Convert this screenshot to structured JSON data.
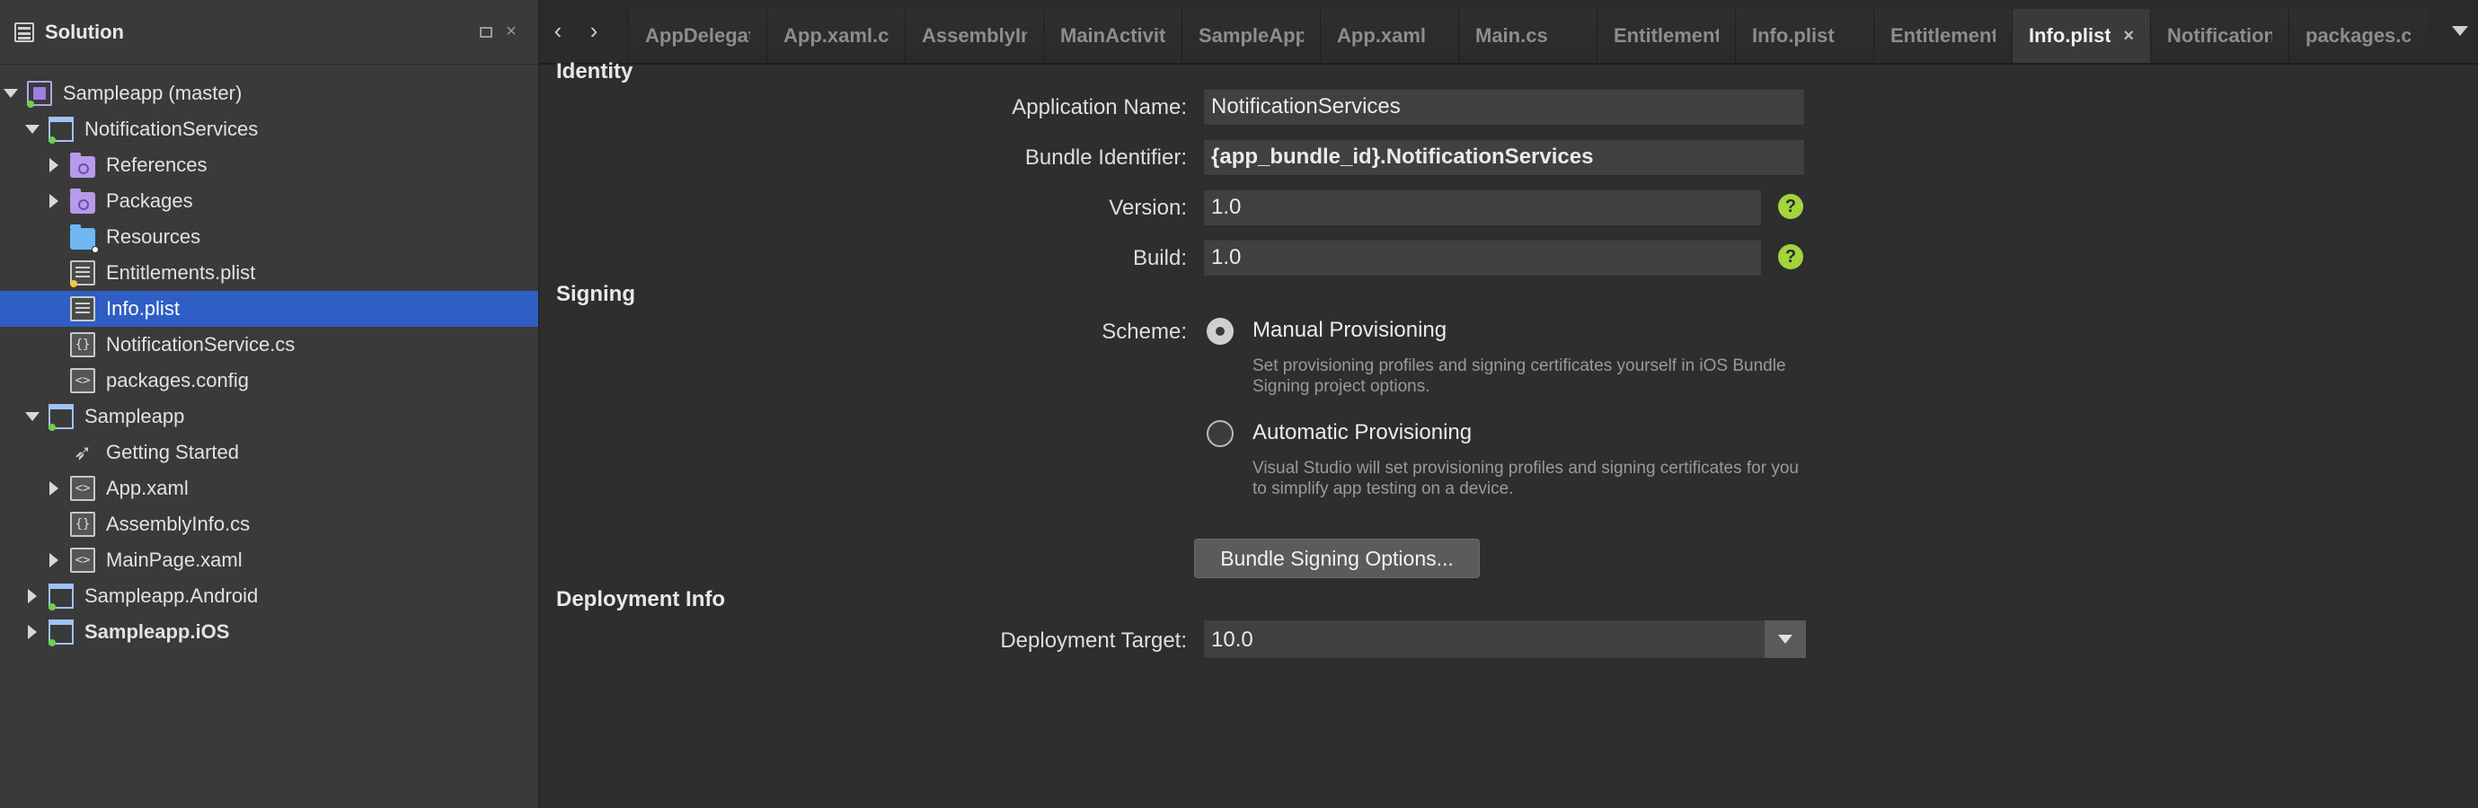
{
  "sidebar": {
    "title": "Solution",
    "items": [
      {
        "label": "Sampleapp (master)",
        "indent": 0,
        "arrow": "down",
        "icon": "solution-icon",
        "dot": "green"
      },
      {
        "label": "NotificationServices",
        "indent": 1,
        "arrow": "down",
        "icon": "project-icon",
        "dot": "green"
      },
      {
        "label": "References",
        "indent": 2,
        "arrow": "right",
        "icon": "references-folder-icon"
      },
      {
        "label": "Packages",
        "indent": 2,
        "arrow": "right",
        "icon": "packages-folder-icon"
      },
      {
        "label": "Resources",
        "indent": 2,
        "arrow": "none",
        "icon": "resources-folder-icon",
        "dot": "white"
      },
      {
        "label": "Entitlements.plist",
        "indent": 2,
        "arrow": "none",
        "icon": "plist-file-icon",
        "dot": "yellow"
      },
      {
        "label": "Info.plist",
        "indent": 2,
        "arrow": "none",
        "icon": "plist-file-icon",
        "selected": true
      },
      {
        "label": "NotificationService.cs",
        "indent": 2,
        "arrow": "none",
        "icon": "csharp-file-icon"
      },
      {
        "label": "packages.config",
        "indent": 2,
        "arrow": "none",
        "icon": "xml-file-icon"
      },
      {
        "label": "Sampleapp",
        "indent": 1,
        "arrow": "down",
        "icon": "project-icon",
        "dot": "green"
      },
      {
        "label": "Getting Started",
        "indent": 2,
        "arrow": "none",
        "icon": "rocket-icon"
      },
      {
        "label": "App.xaml",
        "indent": 2,
        "arrow": "right",
        "icon": "xml-file-icon"
      },
      {
        "label": "AssemblyInfo.cs",
        "indent": 2,
        "arrow": "none",
        "icon": "csharp-file-icon"
      },
      {
        "label": "MainPage.xaml",
        "indent": 2,
        "arrow": "right",
        "icon": "xml-file-icon"
      },
      {
        "label": "Sampleapp.Android",
        "indent": 1,
        "arrow": "right",
        "icon": "project-icon",
        "dot": "green"
      },
      {
        "label": "Sampleapp.iOS",
        "indent": 1,
        "arrow": "right",
        "icon": "project-icon",
        "dot": "green",
        "bold": true
      }
    ]
  },
  "tabs": [
    {
      "label": "AppDelegate.cs"
    },
    {
      "label": "App.xaml.cs"
    },
    {
      "label": "AssemblyInfo.cs"
    },
    {
      "label": "MainActivity.cs"
    },
    {
      "label": "SampleApp"
    },
    {
      "label": "App.xaml"
    },
    {
      "label": "Main.cs"
    },
    {
      "label": "Entitlements.plist"
    },
    {
      "label": "Info.plist"
    },
    {
      "label": "Entitlements.plist"
    },
    {
      "label": "Info.plist",
      "active": true,
      "close": "×"
    },
    {
      "label": "NotificationServices"
    },
    {
      "label": "packages.config"
    }
  ],
  "editor": {
    "identity": {
      "section": "Identity",
      "app_name_label": "Application Name:",
      "app_name_value": "NotificationServices",
      "bundle_id_label": "Bundle Identifier:",
      "bundle_id_value": "{app_bundle_id}.NotificationServices",
      "version_label": "Version:",
      "version_value": "1.0",
      "build_label": "Build:",
      "build_value": "1.0",
      "help_glyph": "?"
    },
    "signing": {
      "section": "Signing",
      "scheme_label": "Scheme:",
      "manual_label": "Manual Provisioning",
      "manual_desc": "Set provisioning profiles and signing certificates yourself in iOS Bundle Signing project options.",
      "automatic_label": "Automatic Provisioning",
      "automatic_desc": "Visual Studio will set provisioning profiles and signing certificates for you to simplify app testing on a device.",
      "selected": "manual",
      "bundle_signing_button": "Bundle Signing Options..."
    },
    "deployment": {
      "section": "Deployment Info",
      "target_label": "Deployment Target:",
      "target_value": "10.0"
    }
  },
  "colors": {
    "selection": "#2f5ec4",
    "help_green": "#a2d43c",
    "background": "#2e2e2e"
  }
}
